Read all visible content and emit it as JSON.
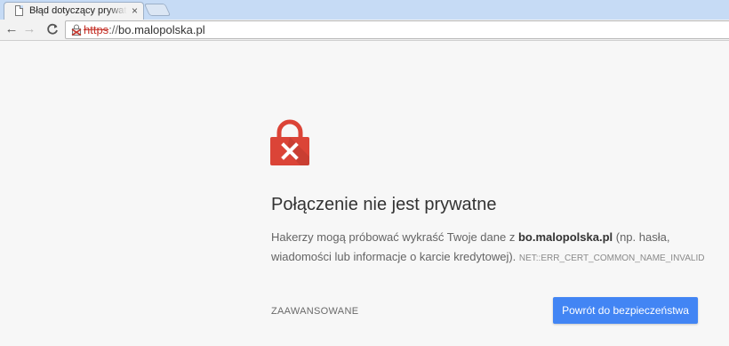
{
  "browser": {
    "tab": {
      "title": "Błąd dotyczący prywatności",
      "close_glyph": "×"
    },
    "nav": {
      "back_glyph": "←",
      "forward_glyph": "→",
      "reload_glyph": "C"
    },
    "omnibox": {
      "scheme": "https",
      "separator": "://",
      "host": "bo.malopolska.pl",
      "security_icon": "broken-lock-icon"
    }
  },
  "interstitial": {
    "icon": "red-lock-x-icon",
    "icon_color": "#db4437",
    "heading": "Połączenie nie jest prywatne",
    "message_before": "Hakerzy mogą próbować wykraść Twoje dane z ",
    "host": "bo.malopolska.pl",
    "message_after": " (np. hasła, wiadomości lub informacje o karcie kredytowej). ",
    "error_code": "NET::ERR_CERT_COMMON_NAME_INVALID",
    "advanced_label": "ZAAWANSOWANE",
    "back_to_safety_label": "Powrót do bezpieczeństwa",
    "primary_color": "#4285f4"
  }
}
